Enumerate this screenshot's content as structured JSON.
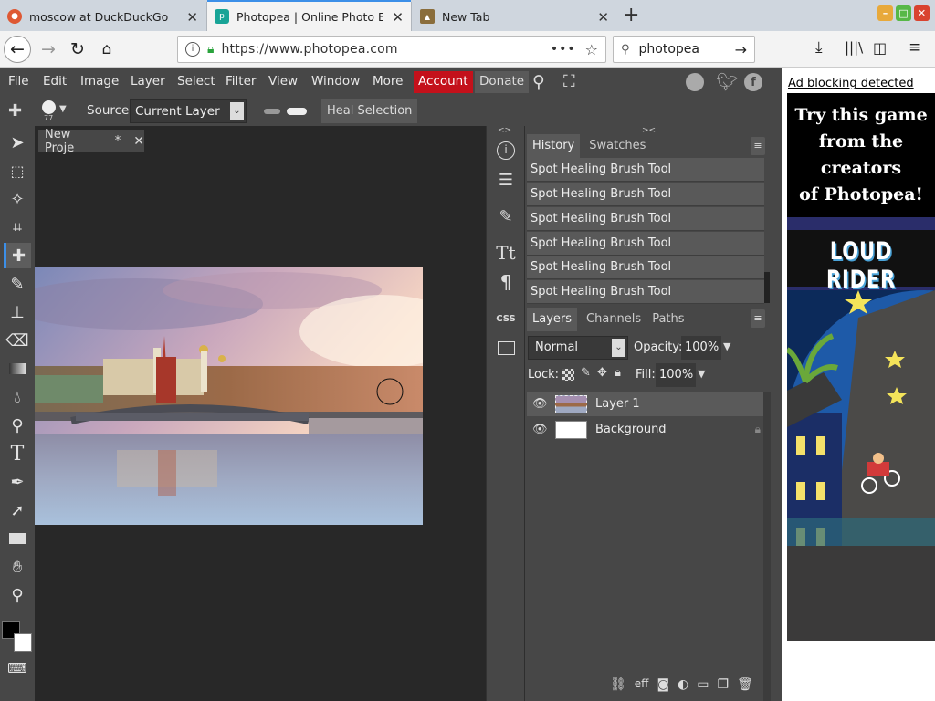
{
  "browser": {
    "tabs": [
      {
        "title": "moscow at DuckDuckGo",
        "active": false
      },
      {
        "title": "Photopea | Online Photo Editor",
        "active": true
      },
      {
        "title": "New Tab",
        "active": false
      }
    ],
    "url": "https://www.photopea.com",
    "search_value": "photopea",
    "new_tab_symbol": "+"
  },
  "menu": {
    "items": [
      "File",
      "Edit",
      "Image",
      "Layer",
      "Select",
      "Filter",
      "View",
      "Window",
      "More"
    ],
    "account": "Account",
    "donate": "Donate"
  },
  "options": {
    "brush_size": "77",
    "source_label": "Source:",
    "source_value": "Current Layer",
    "heal_button": "Heal Selection"
  },
  "document": {
    "tab_title": "New Proje",
    "modified_mark": "*"
  },
  "history": {
    "tab_history": "History",
    "tab_swatches": "Swatches",
    "items": [
      "Spot Healing Brush Tool",
      "Spot Healing Brush Tool",
      "Spot Healing Brush Tool",
      "Spot Healing Brush Tool",
      "Spot Healing Brush Tool",
      "Spot Healing Brush Tool"
    ]
  },
  "layers": {
    "tab_layers": "Layers",
    "tab_channels": "Channels",
    "tab_paths": "Paths",
    "blend_mode": "Normal",
    "opacity_label": "Opacity:",
    "opacity_value": "100%",
    "lock_label": "Lock:",
    "fill_label": "Fill:",
    "fill_value": "100%",
    "list": [
      {
        "name": "Layer 1",
        "selected": true,
        "locked": false
      },
      {
        "name": "Background",
        "selected": false,
        "locked": true
      }
    ],
    "fx_label": "eff"
  },
  "ad": {
    "notice": "Ad blocking detected",
    "headline_lines": [
      "Try this game",
      "from the",
      "creators",
      "of Photopea!"
    ],
    "game_title": "LOUD RIDER"
  },
  "colors": {
    "menu_bg": "#474747",
    "canvas_bg": "#282828",
    "account_red": "#c4111b",
    "browser_accent": "#3c8fe8"
  }
}
